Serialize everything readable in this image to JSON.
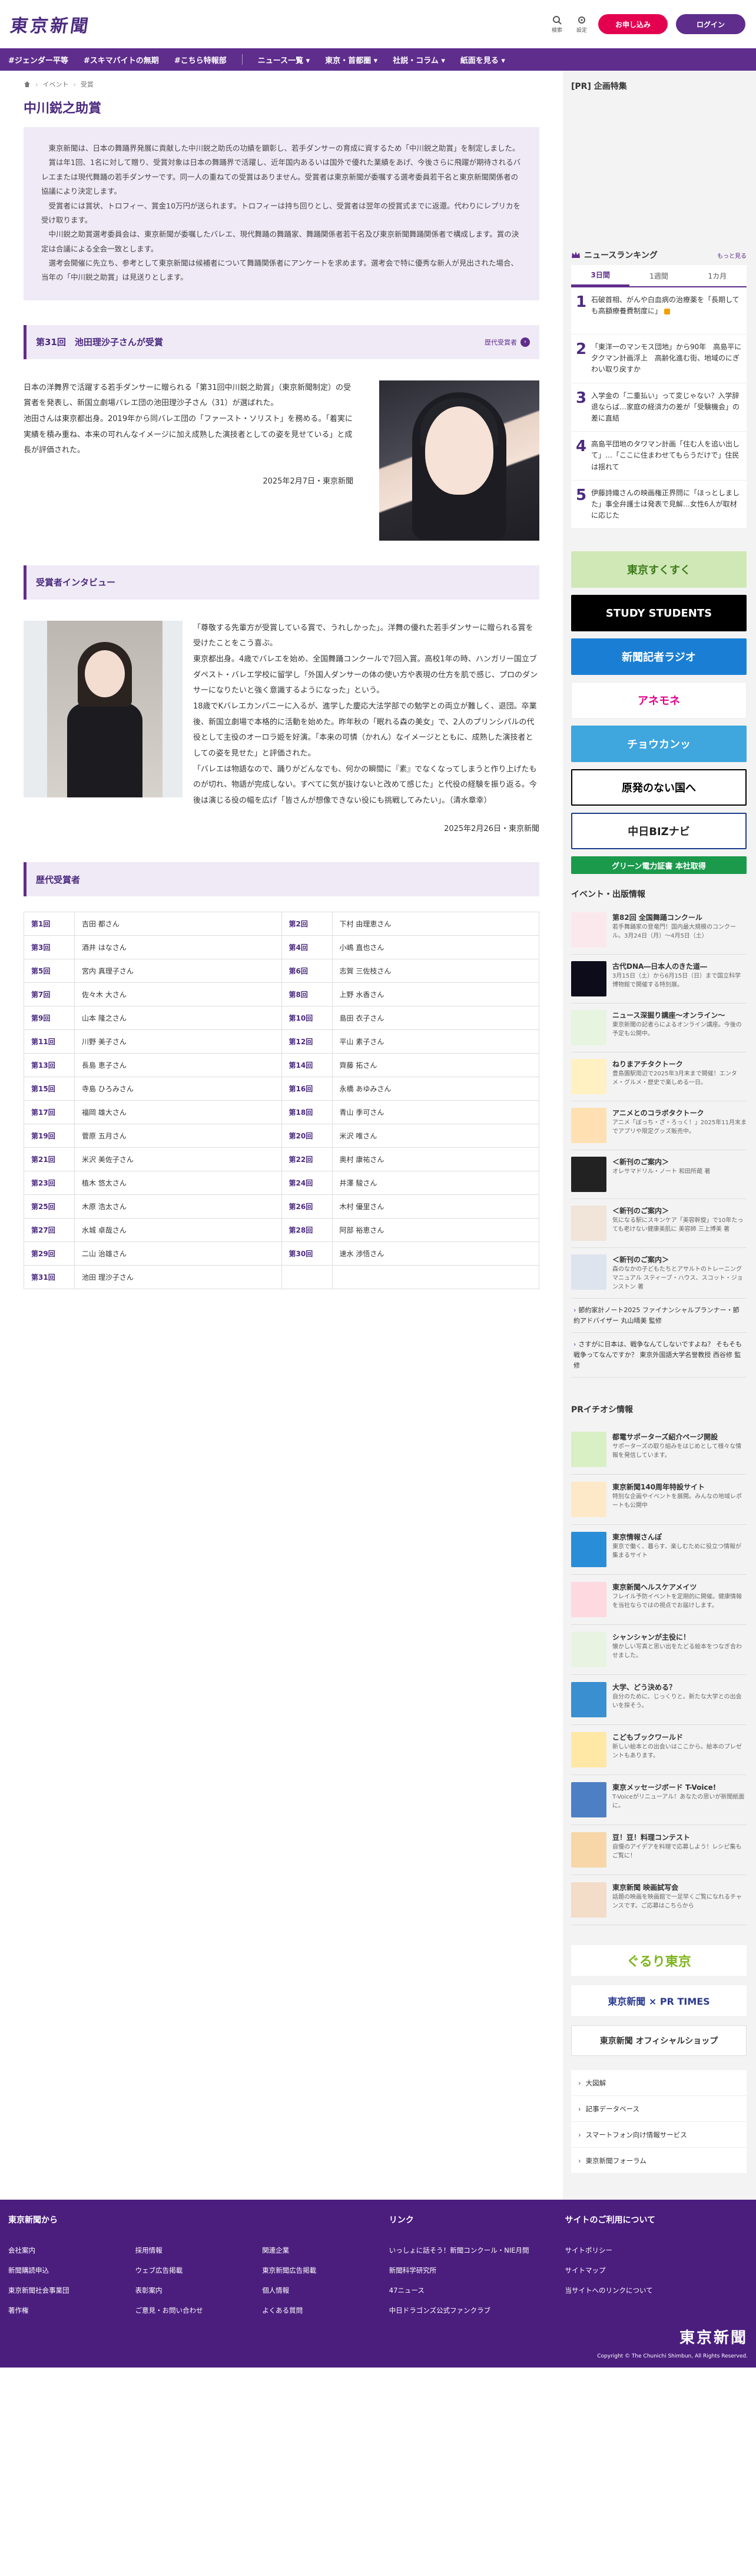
{
  "header": {
    "logo": "東京新聞",
    "search_label": "検索",
    "settings_label": "設定",
    "subscribe_label": "お申し込み",
    "login_label": "ログイン"
  },
  "nav": [
    "#ジェンダー平等",
    "#スキマバイトの無期",
    "#こちら特報部",
    "ニュース一覧 ▾",
    "東京・首都圏 ▾",
    "社説・コラム ▾",
    "紙面を見る ▾"
  ],
  "breadcrumb": [
    "イベント",
    "受賞"
  ],
  "page_title": "中川鋭之助賞",
  "intro": [
    "東京新聞は、日本の舞踊界発展に貢献した中川鋭之助氏の功績を顕彰し、若手ダンサーの育成に資するため「中川鋭之助賞」を制定しました。",
    "賞は年1回、1名に対して贈り、受賞対象は日本の舞踊界で活躍し、近年国内あるいは国外で優れた業績をあげ、今後さらに飛躍が期待されるバレエまたは現代舞踊の若手ダンサーです。同一人の重ねての受賞はありません。受賞者は東京新聞が委嘱する選考委員若干名と東京新聞関係者の協議により決定します。",
    "受賞者には賞状、トロフィー、賞金10万円が送られます。トロフィーは持ち回りとし、受賞者は翌年の授賞式までに返還。代わりにレプリカを受け取ります。",
    "中川鋭之助賞選考委員会は、東京新聞が委嘱したバレエ、現代舞踊の舞踊家、舞踊関係者若干名及び東京新聞舞踊関係者で構成します。賞の決定は合議による全会一致とします。",
    "選考会開催に先立ち、参考として東京新聞は候補者について舞踊関係者にアンケートを求めます。選考会で特に優秀な新人が見出された場合、当年の「中川鋭之助賞」は見送りとします。"
  ],
  "winner": {
    "section_title": "第31回　池田理沙子さんが受賞",
    "more_label": "歴代受賞者",
    "paragraphs": [
      "日本の洋舞界で活躍する若手ダンサーに贈られる「第31回中川鋭之助賞」（東京新聞制定）の受賞者を発表し、新国立劇場バレエ団の池田理沙子さん（31）が選ばれた。",
      "池田さんは東京都出身。2019年から同バレエ団の「ファースト・ソリスト」を務める。「着実に実績を積み重ね、本来の可れんなイメージに加え成熟した演技者としての姿を見せている」と成長が評価された。"
    ],
    "date": "2025年2月7日・東京新聞"
  },
  "interview": {
    "section_title": "受賞者インタビュー",
    "paragraphs": [
      "「尊敬する先輩方が受賞している賞で、うれしかった」。洋舞の優れた若手ダンサーに贈られる賞を受けたことをこう喜ぶ。",
      "東京都出身。4歳でバレエを始め、全国舞踊コンクールで7回入賞。高校1年の時、ハンガリー国立ブダペスト・バレエ学校に留学し「外国人ダンサーの体の使い方や表現の仕方を肌で感じ、プロのダンサーになりたいと強く意識するようになった」という。",
      "18歳でKバレエカンパニーに入るが、進学した慶応大法学部での勉学との両立が難しく、退団。卒業後、新国立劇場で本格的に活動を始めた。昨年秋の「眠れる森の美女」で、2人のプリンシパルの代役として主役のオーロラ姫を好演。「本来の可憐（かれん）なイメージとともに、成熟した演技者としての姿を見せた」と評価された。",
      "「バレエは物語なので、踊りがどんなでも、何かの瞬間に『素』でなくなってしまうと作り上げたものが切れ、物語が完成しない。すべてに気が抜けないと改めて感じた」と代役の経験を振り返る。今後は演じる役の幅を広げ「皆さんが想像できない役にも挑戦してみたい」。（清水章幸）"
    ],
    "date": "2025年2月26日・東京新聞"
  },
  "history": {
    "section_title": "歴代受賞者",
    "rows": [
      [
        {
          "no": "第1回",
          "name": "吉田 都さん"
        },
        {
          "no": "第2回",
          "name": "下村 由理恵さん"
        }
      ],
      [
        {
          "no": "第3回",
          "name": "酒井 はなさん"
        },
        {
          "no": "第4回",
          "name": "小嶋 直也さん"
        }
      ],
      [
        {
          "no": "第5回",
          "name": "宮内 真理子さん"
        },
        {
          "no": "第6回",
          "name": "志賀 三佐枝さん"
        }
      ],
      [
        {
          "no": "第7回",
          "name": "佐々木 大さん"
        },
        {
          "no": "第8回",
          "name": "上野 水香さん"
        }
      ],
      [
        {
          "no": "第9回",
          "name": "山本 隆之さん"
        },
        {
          "no": "第10回",
          "name": "島田 衣子さん"
        }
      ],
      [
        {
          "no": "第11回",
          "name": "川野 美子さん"
        },
        {
          "no": "第12回",
          "name": "平山 素子さん"
        }
      ],
      [
        {
          "no": "第13回",
          "name": "長島 恵子さん"
        },
        {
          "no": "第14回",
          "name": "齊藤 拓さん"
        }
      ],
      [
        {
          "no": "第15回",
          "name": "寺島 ひろみさん"
        },
        {
          "no": "第16回",
          "name": "永橋 あゆみさん"
        }
      ],
      [
        {
          "no": "第17回",
          "name": "福岡 雄大さん"
        },
        {
          "no": "第18回",
          "name": "青山 季可さん"
        }
      ],
      [
        {
          "no": "第19回",
          "name": "菅原 五月さん"
        },
        {
          "no": "第20回",
          "name": "米沢 唯さん"
        }
      ],
      [
        {
          "no": "第21回",
          "name": "米沢 美佐子さん"
        },
        {
          "no": "第22回",
          "name": "奥村 康祐さん"
        }
      ],
      [
        {
          "no": "第23回",
          "name": "植木 悠太さん"
        },
        {
          "no": "第24回",
          "name": "井澤 駿さん"
        }
      ],
      [
        {
          "no": "第25回",
          "name": "木原 浩太さん"
        },
        {
          "no": "第26回",
          "name": "木村 優里さん"
        }
      ],
      [
        {
          "no": "第27回",
          "name": "水城 卓哉さん"
        },
        {
          "no": "第28回",
          "name": "阿部 裕恵さん"
        }
      ],
      [
        {
          "no": "第29回",
          "name": "二山 治雄さん"
        },
        {
          "no": "第30回",
          "name": "速水 渉悟さん"
        }
      ],
      [
        {
          "no": "第31回",
          "name": "池田 理沙子さん"
        },
        {
          "no": "",
          "name": ""
        }
      ]
    ]
  },
  "sidebar": {
    "pr_title": "[PR] 企画特集",
    "ranking_title": "ニュースランキング",
    "ranking_more": "もっと見る",
    "tabs": [
      "3日間",
      "1週間",
      "1カ月"
    ],
    "ranking": [
      "石破首相、がんや白血病の治療薬を「長期しても高額療養費制度に」",
      "「東洋一のマンモス団地」から90年　高島平に夕クマン計画浮上　高齢化進む街、地域のにぎわい取り戻すか",
      "入学金の「二重払い」って変じゃない？入学辞退ならば…家庭の経済力の差が「受験機会」の差に直結",
      "高島平団地のタワマン計画「住む人を追い出して」…「ここに住まわせてもらうだけで」住民は揺れて",
      "伊藤詩織さんの映画権正界問に「ほっとしました」事全弁護士は発表で見解…女性6人が取材に応じた"
    ],
    "banners": [
      "東京すくすく",
      "STUDY STUDENTS",
      "新聞記者ラジオ",
      "アネモネ",
      "チョウカンッ",
      "原発のない国へ",
      "中日BIZナビ",
      "グリーン電力証書 本社取得"
    ],
    "events_title": "イベント・出版情報",
    "events": [
      {
        "t": "第82回 全国舞踊コンクール",
        "d": "若手舞踊家の登竜門！国内最大規模のコンクール。3月24日（月）〜4月5日（土）"
      },
      {
        "t": "古代DNA―日本人のきた道―",
        "d": "3月15日（土）から6月15日（日）まで国立科学博物館で開催する特別展。"
      },
      {
        "t": "ニュース深掘り講座〜オンライン〜",
        "d": "東京新聞の記者らによるオンライン講座。今後の予定も公開中。"
      },
      {
        "t": "ねりまアチタクトーク",
        "d": "豊島園駅周辺で2025年3月末まで開催！エンタメ・グルメ・歴史で楽しめる一日。"
      },
      {
        "t": "アニメとのコラボタクトーク",
        "d": "アニメ「ぼっち・ざ・ろっく！」2025年11月末までアプリや限定グッズ販売中。"
      },
      {
        "t": "＜新刊のご案内＞",
        "d": "オレサマドリル・ノート 和田所蔵 著"
      },
      {
        "t": "＜新刊のご案内＞",
        "d": "気になる駅にスキンケア「美容幹旋」で10年たっても老けない健康美肌に 美容師 三上博美 著"
      },
      {
        "t": "＜新刊のご案内＞",
        "d": "森のなかの子どもたちとアサルトのトレーニングマニュアル スティーブ・ハウス、スコット・ジョンストン 著"
      }
    ],
    "plain_links": [
      "節約家計ノート2025 ファイナンシャルプランナー・節約アドバイザー 丸山晴美 監修",
      "さすがに日本は、戦争なんてしないですよね？ そもそも戦争ってなんですか？ 東京外国語大学名誉教授 西谷修 監修"
    ],
    "pr2_title": "PRイチオシ情報",
    "pr2": [
      {
        "t": "都電サポーターズ紹介ページ開設",
        "d": "サポーターズの取り組みをはじめとして様々な情報を発信しています。"
      },
      {
        "t": "東京新聞140周年特設サイト",
        "d": "特別な企画やイベントを展開。みんなの地域レポートも公開中"
      },
      {
        "t": "東京情報さんぽ",
        "d": "東京で働く、暮らす、楽しむために役立つ情報が集まるサイト"
      },
      {
        "t": "東京新聞ヘルスケアメイツ",
        "d": "フレイル予防イベントを定期的に開催。健康情報を当社ならではの視点でお届けします。"
      },
      {
        "t": "シャンシャンが主役に！",
        "d": "懐かしい写真と思い出をたどる絵本をつなぎ合わせました。"
      },
      {
        "t": "大学、どう決める？",
        "d": "自分のために、じっくりと。新たな大学との出会いを探そう。"
      },
      {
        "t": "こどもブックワールド",
        "d": "新しい絵本との出会いはここから。絵本のプレゼントもあります。"
      },
      {
        "t": "東京メッセージボード T-Voice!",
        "d": "T-Voiceがリニューアル！あなたの思いが新聞紙面に。"
      },
      {
        "t": "豆！豆！料理コンテスト",
        "d": "自慢のアイデアを料理で応募しよう！レシピ集もご覧に！"
      },
      {
        "t": "東京新聞 映画試写会",
        "d": "話題の映画を映画館で一足早くご覧になれるチャンスです。ご応募はこちらから"
      }
    ],
    "logo_banners": [
      "ぐるり東京",
      "東京新聞 × PR TIMES",
      "東京新聞 オフィシャルショップ"
    ],
    "links": [
      "大図解",
      "記事データベース",
      "スマートフォン向け情報サービス",
      "東京新聞フォーラム"
    ]
  },
  "footer": {
    "col1_title": "東京新聞から",
    "col1": [
      "会社案内",
      "採用情報",
      "関連企業",
      "新聞購読申込",
      "ウェブ広告掲載",
      "東京新聞広告掲載",
      "東京新聞社会事業団",
      "表彰案内",
      "個人情報",
      "著作権",
      "ご意見・お問い合わせ",
      "よくある質問"
    ],
    "col2_title": "リンク",
    "col2": [
      "いっしょに話そう！新聞コンクール・NIE月間",
      "新聞科学研究所",
      "47ニュース",
      "中日ドラゴンズ公式ファンクラブ"
    ],
    "col3_title": "サイトのご利用について",
    "col3": [
      "サイトポリシー",
      "サイトマップ",
      "当サイトへのリンクについて"
    ],
    "logo": "東京新聞",
    "copyright": "Copyright © The Chunichi Shimbun, All Rights Reserved."
  }
}
